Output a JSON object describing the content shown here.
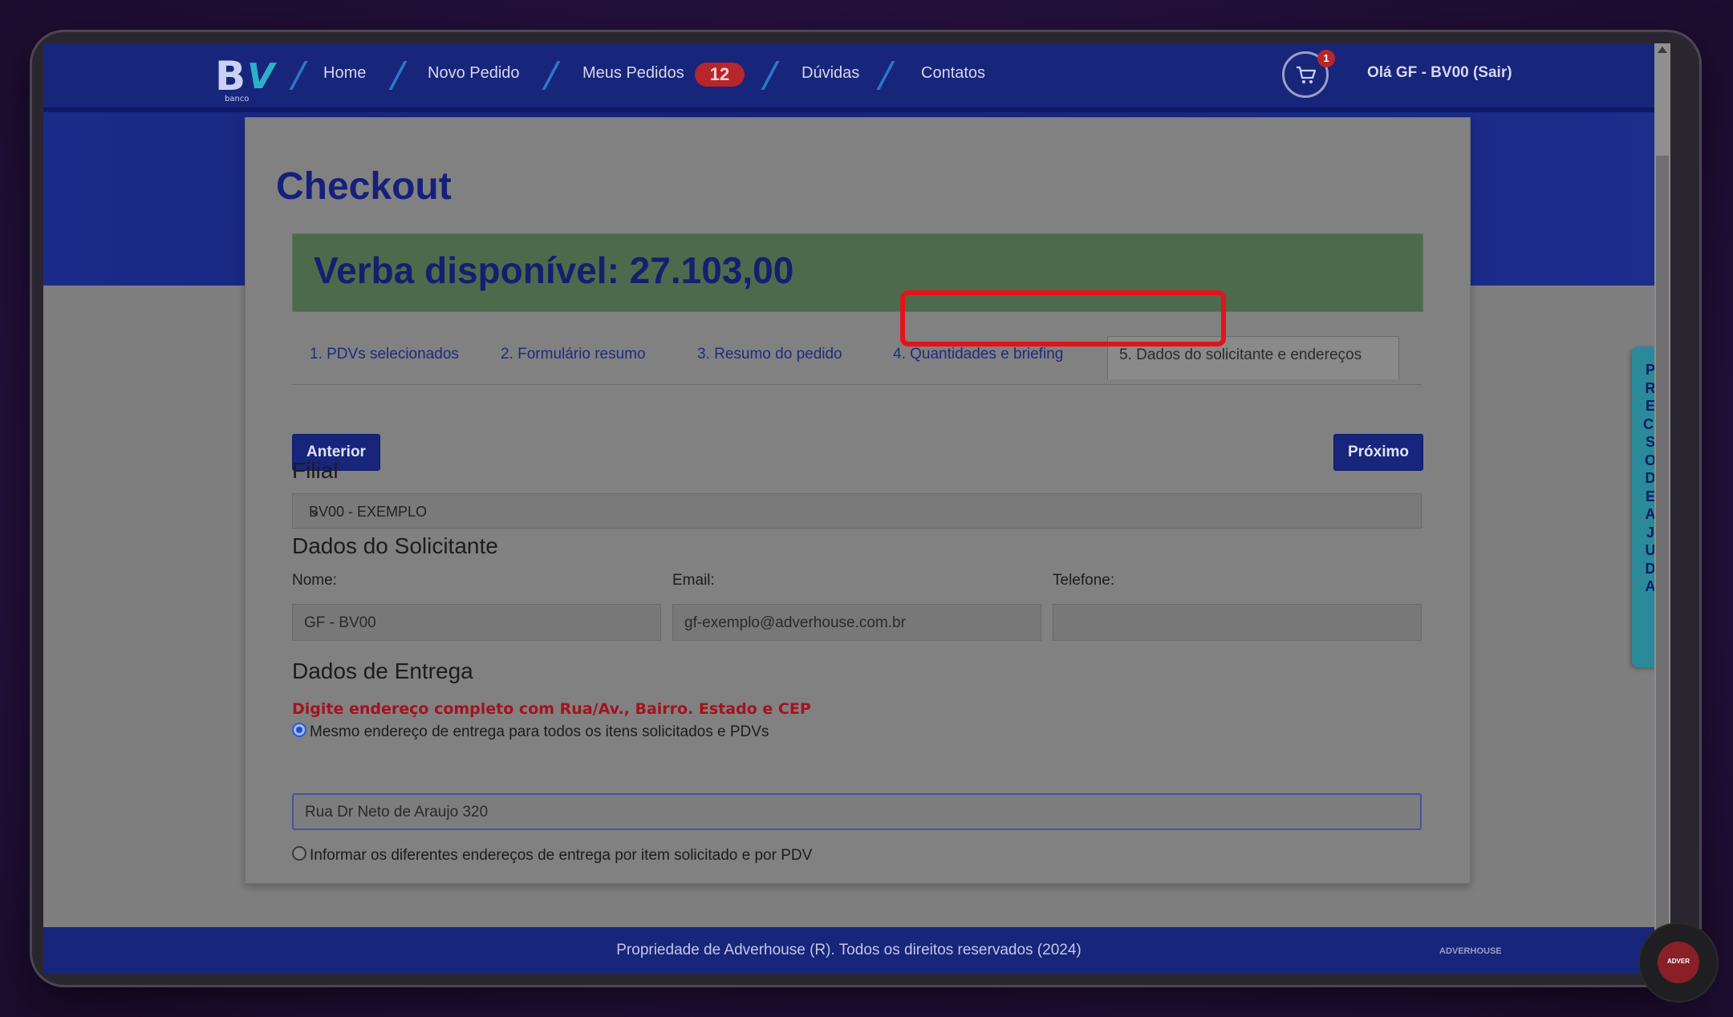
{
  "nav": {
    "logo_letters_b": "B",
    "logo_letters_v": "V",
    "logo_sub": "banco",
    "links": [
      "Home",
      "Novo Pedido",
      "Meus Pedidos",
      "Dúvidas",
      "Contatos"
    ],
    "orders_count": "12",
    "cart_count": "1",
    "greeting": "Olá GF - BV00 (Sair)"
  },
  "page": {
    "title": "Checkout",
    "verba": "Verba disponível: 27.103,00"
  },
  "tabs": [
    "1. PDVs selecionados",
    "2. Formulário resumo",
    "3. Resumo do pedido",
    "4. Quantidades e briefing",
    "5. Dados do solicitante e endereços"
  ],
  "buttons": {
    "prev": "Anterior",
    "next": "Próximo"
  },
  "filial": {
    "heading": "Filial",
    "selected": "BV00 - EXEMPLO"
  },
  "solicitante": {
    "heading": "Dados do Solicitante",
    "nome_label": "Nome:",
    "nome_value": "GF - BV00",
    "email_label": "Email:",
    "email_value": "gf-exemplo@adverhouse.com.br",
    "telefone_label": "Telefone:",
    "telefone_value": ""
  },
  "entrega": {
    "heading": "Dados de Entrega",
    "warning": "Digite endereço completo com Rua/Av., Bairro. Estado e CEP",
    "option_same": "Mesmo endereço de entrega para todos os itens solicitados e PDVs",
    "address_value": "Rua Dr Neto de Araujo 320",
    "option_diff": "Informar os diferentes endereços de entrega por item solicitado e por PDV"
  },
  "help_tab": "PRECISO DE AJUDA",
  "footer": {
    "text": "Propriedade de Adverhouse (R). Todos os direitos reservados (2024)",
    "logo": "ADVERHOUSE"
  },
  "avatar_label": "ADVER"
}
